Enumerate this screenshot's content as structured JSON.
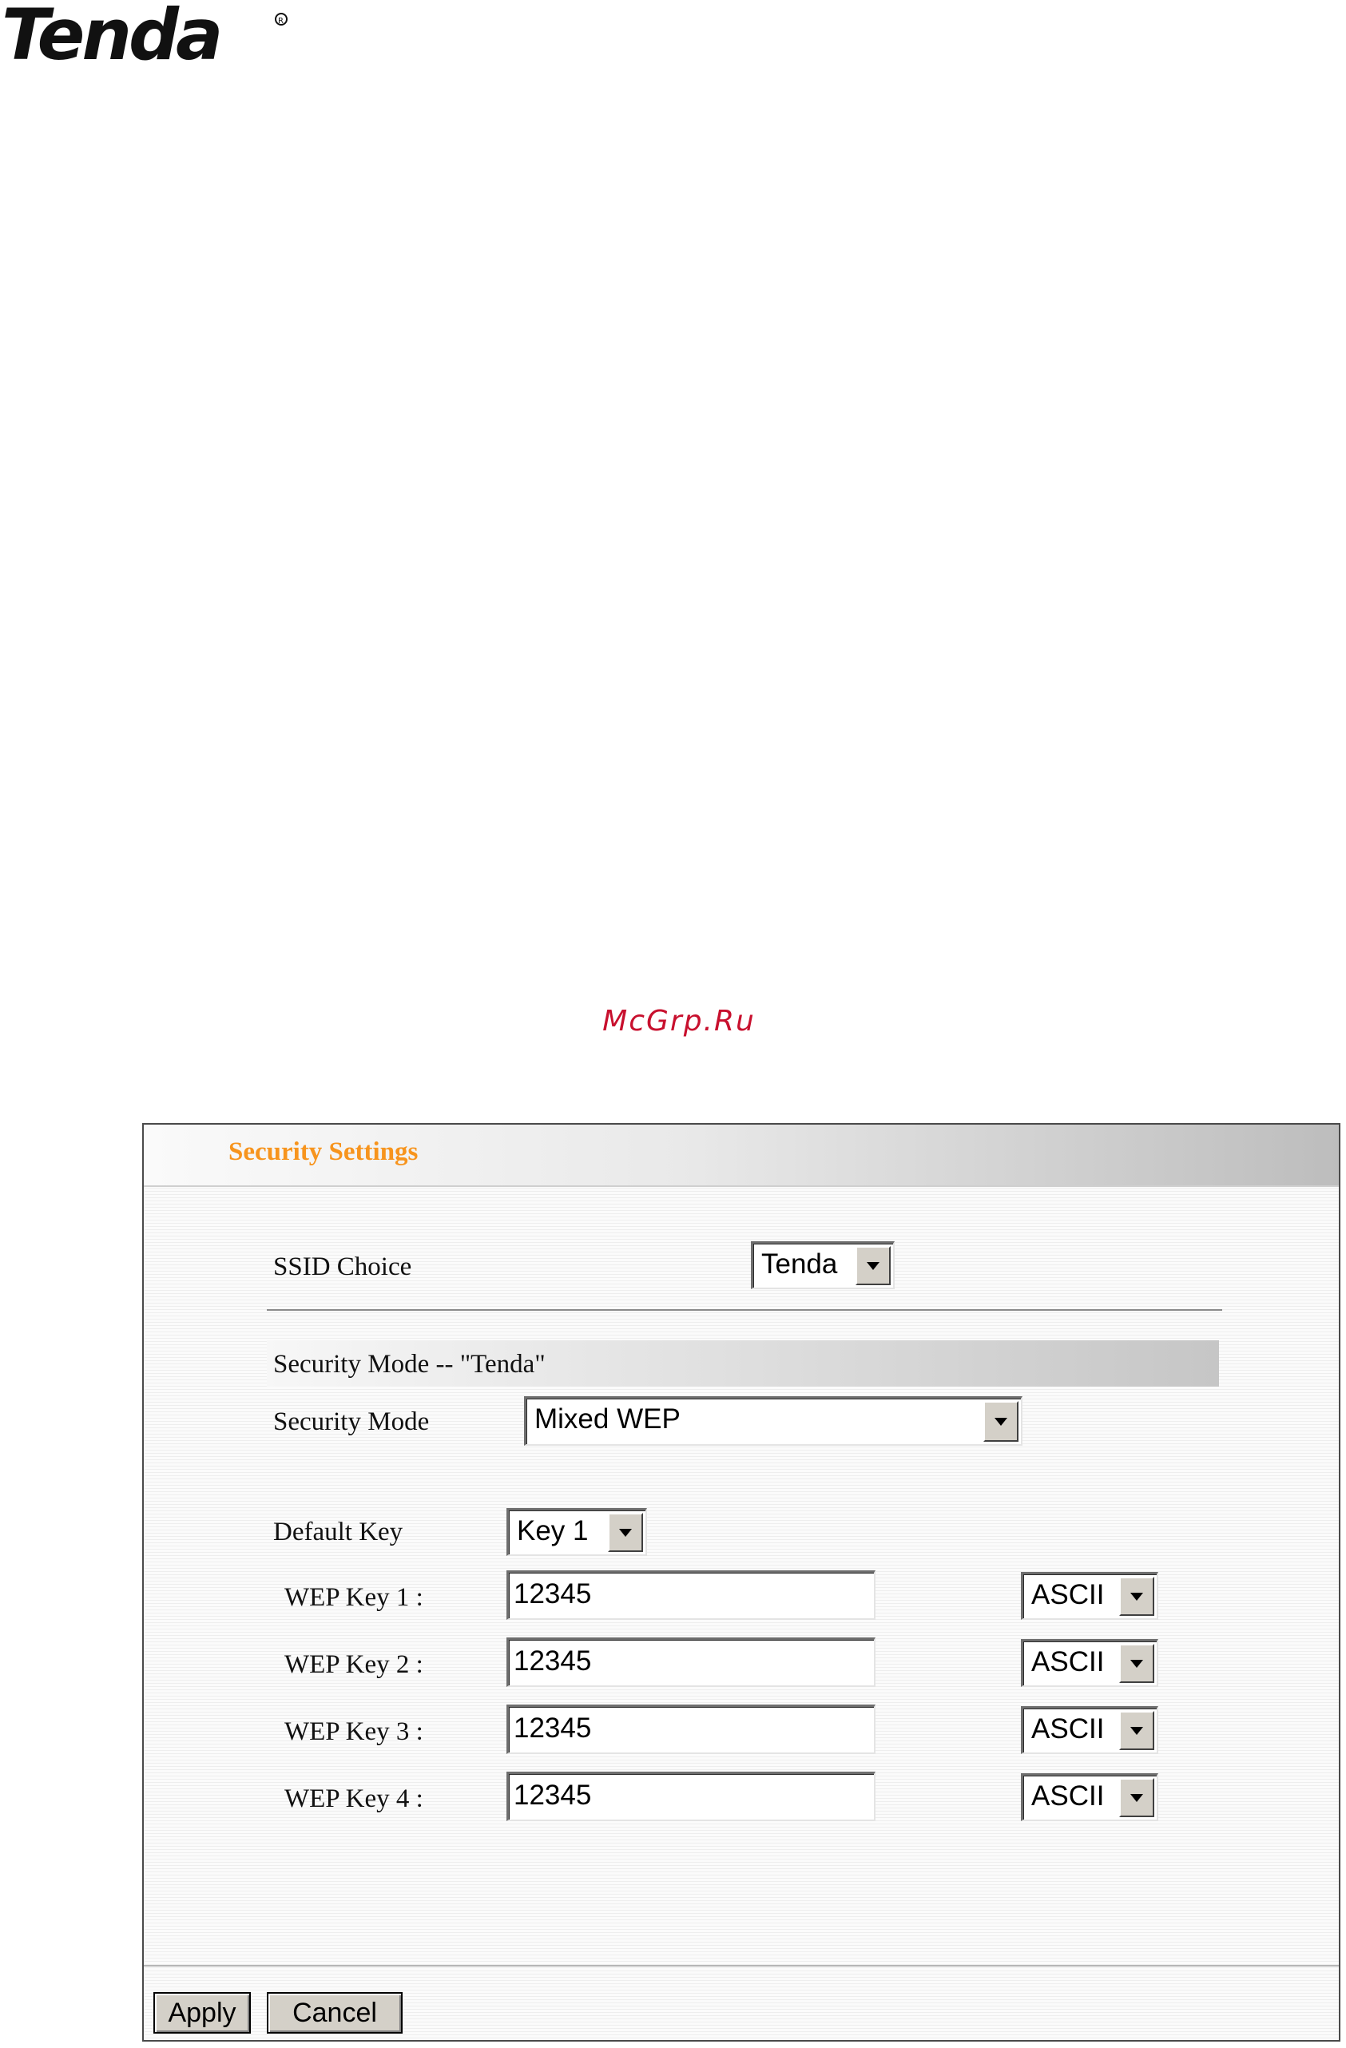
{
  "brand": {
    "logo_text": "Tenda"
  },
  "watermark": "McGrp.Ru",
  "panel": {
    "title": "Security Settings",
    "ssid_choice": {
      "label": "SSID Choice",
      "selected": "Tenda"
    },
    "section_title": "Security Mode -- \"Tenda\"",
    "security_mode": {
      "label": "Security Mode",
      "selected": "Mixed WEP"
    },
    "default_key": {
      "label": "Default Key",
      "selected": "Key 1"
    },
    "wep_keys": [
      {
        "label": "WEP Key 1 :",
        "value": "12345",
        "format": "ASCII"
      },
      {
        "label": "WEP Key 2 :",
        "value": "12345",
        "format": "ASCII"
      },
      {
        "label": "WEP Key 3 :",
        "value": "12345",
        "format": "ASCII"
      },
      {
        "label": "WEP Key 4 :",
        "value": "12345",
        "format": "ASCII"
      }
    ],
    "buttons": {
      "apply": "Apply",
      "cancel": "Cancel"
    }
  },
  "colors": {
    "title": "#f7941d",
    "watermark": "#c8102e",
    "logo": "#111111"
  }
}
